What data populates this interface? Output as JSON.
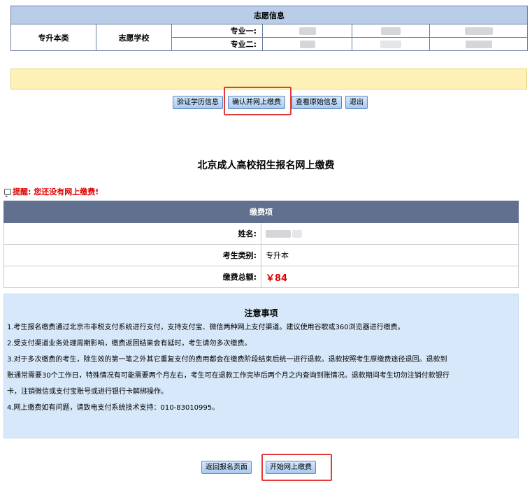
{
  "volunteer": {
    "header": "志愿信息",
    "category": "专升本类",
    "school_label": "志愿学校",
    "major1_label": "专业一:",
    "major2_label": "专业二:"
  },
  "actions": {
    "verify": "验证学历信息",
    "confirm_pay": "确认并网上缴费",
    "view_original": "查看原始信息",
    "exit": "退出"
  },
  "payment": {
    "title": "北京成人高校招生报名网上缴费",
    "reminder": "提醒:  您还没有网上缴费!",
    "table_header": "缴费项",
    "name_label": "姓名:",
    "type_label": "考生类别:",
    "type_value": "专升本",
    "total_label": "缴费总额:",
    "total_value": "￥84"
  },
  "notes": {
    "title": "注意事项",
    "line1": "1.考生报名缴费通过北京市非税支付系统进行支付，支持支付宝、微信两种网上支付渠道。建议使用谷歌或360浏览器进行缴费。",
    "line2": "2.受支付渠道业务处理周期影响，缴费返回结果会有延时，考生请勿多次缴费。",
    "line3a": "3.对于多次缴费的考生，除生效的第一笔之外其它重复支付的费用都会在缴费阶段结束后统一进行退款。退款按照考生原缴费途径退回。退款到",
    "line3b": "账通常需要30个工作日，特殊情况有可能需要两个月左右，考生可在退款工作完毕后两个月之内查询到账情况。退款期间考生切勿注销付款银行",
    "line3c": "卡，注销微信或支付宝账号或进行银行卡解绑操作。",
    "line4": "4.网上缴费如有问题，请致电支付系统技术支持：010-83010995。"
  },
  "bottom_actions": {
    "back": "返回报名页面",
    "start_pay": "开始网上缴费"
  },
  "colors": {
    "highlight": "#e53a3a",
    "reminder": "#e00000",
    "table_header": "#61708f"
  }
}
